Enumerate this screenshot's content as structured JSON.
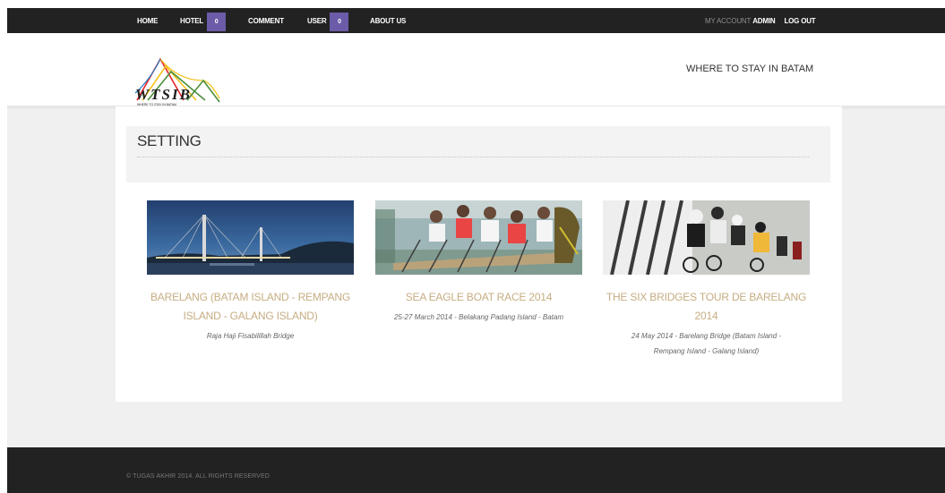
{
  "nav": {
    "home": "HOME",
    "hotel": "HOTEL",
    "hotel_count": "0",
    "comment": "COMMENT",
    "user": "USER",
    "user_count": "0",
    "about": "ABOUT US",
    "my_account": "MY ACCOUNT",
    "username": "ADMIN",
    "logout": "LOG OUT"
  },
  "header": {
    "logo_text": "WTSIB",
    "logo_subtext": "WHERE TO STAY IN BATAM",
    "tagline": "WHERE TO STAY IN BATAM"
  },
  "main": {
    "title": "SETTING",
    "cards": [
      {
        "title_line1": "BARELANG (BATAM ISLAND - REMPANG",
        "title_line2": "ISLAND - GALANG ISLAND)",
        "subtitle_line1": "Raja Haji Fisabilillah Bridge",
        "subtitle_line2": ""
      },
      {
        "title_line1": "SEA EAGLE BOAT RACE 2014",
        "title_line2": "",
        "subtitle_line1": "25-27 March 2014 - Belakang Padang Island - Batam",
        "subtitle_line2": ""
      },
      {
        "title_line1": "THE SIX BRIDGES TOUR DE BARELANG",
        "title_line2": "2014",
        "subtitle_line1": "24 May 2014 - Barelang Bridge (Batam Island -",
        "subtitle_line2": "Rempang Island - Galang Island)"
      }
    ]
  },
  "footer": {
    "copyright": "© TUGAS AKHIR 2014. ALL RIGHTS RESERVED"
  },
  "colors": {
    "nav_bg": "#222222",
    "badge": "#6b5ba8",
    "card_title": "#c6ad82",
    "footer_bg": "#222222"
  }
}
